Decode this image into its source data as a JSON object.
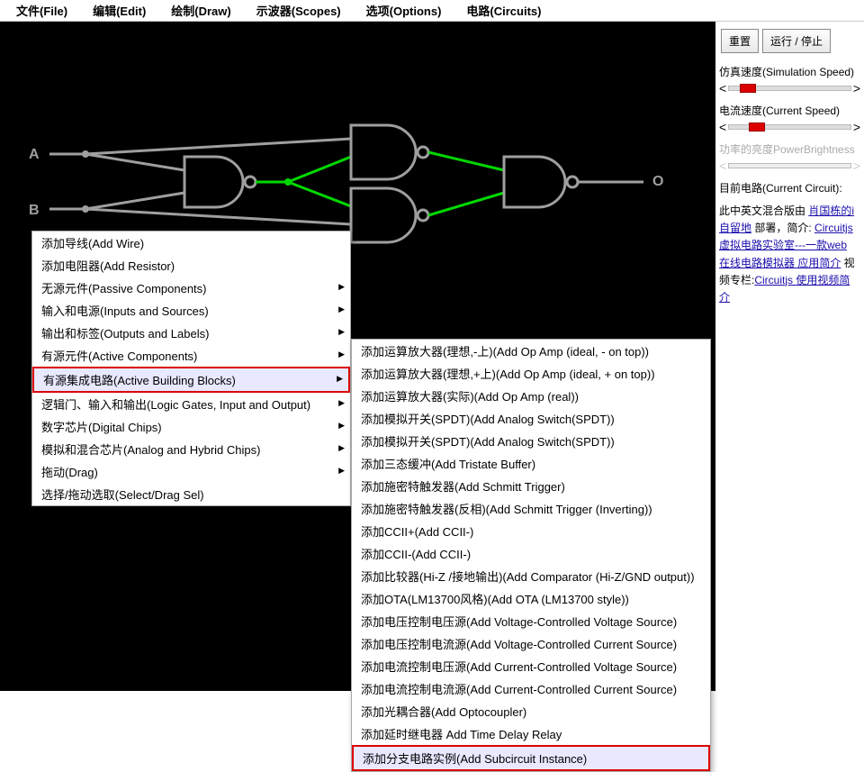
{
  "menubar": {
    "items": [
      {
        "label": "文件(File)"
      },
      {
        "label": "编辑(Edit)"
      },
      {
        "label": "绘制(Draw)"
      },
      {
        "label": "示波器(Scopes)"
      },
      {
        "label": "选项(Options)"
      },
      {
        "label": "电路(Circuits)"
      }
    ]
  },
  "buttons": {
    "reset": "重置",
    "run_stop": "运行 / 停止"
  },
  "sliders": {
    "sim_speed": "仿真速度(Simulation Speed)",
    "current_speed": "电流速度(Current Speed)",
    "power_brightness": "功率的亮度PowerBrightness"
  },
  "labels": {
    "current_circuit": "目前电路(Current Circuit):",
    "input_a": "A",
    "input_b": "B",
    "output_o": "O"
  },
  "info": {
    "t1": "此中英文混合版由 ",
    "link1": "肖国栋的i自留地",
    "t2": " 部署，简介: ",
    "link2": "Circuitjs 虚拟电路实验室---一款web 在线电路模拟器 应用简介",
    "t3": " 视频专栏:",
    "link3": "Circuitjs 使用视频简介"
  },
  "context_menu_1": {
    "items": [
      {
        "label": "添加导线(Add Wire)"
      },
      {
        "label": "添加电阻器(Add Resistor)"
      },
      {
        "label": "无源元件(Passive Components)",
        "sub": true
      },
      {
        "label": "输入和电源(Inputs and Sources)",
        "sub": true
      },
      {
        "label": "输出和标签(Outputs and Labels)",
        "sub": true
      },
      {
        "label": "有源元件(Active Components)",
        "sub": true
      },
      {
        "label": "有源集成电路(Active Building Blocks)",
        "sub": true,
        "highlighted": true,
        "redbox": true
      },
      {
        "label": "逻辑门、输入和输出(Logic Gates, Input and Output)",
        "sub": true
      },
      {
        "label": "数字芯片(Digital Chips)",
        "sub": true
      },
      {
        "label": "模拟和混合芯片(Analog and Hybrid Chips)",
        "sub": true
      },
      {
        "label": "拖动(Drag)",
        "sub": true
      },
      {
        "label": "选择/拖动选取(Select/Drag Sel)"
      }
    ]
  },
  "context_menu_2": {
    "items": [
      {
        "label": "添加运算放大器(理想,-上)(Add Op Amp (ideal, - on top))"
      },
      {
        "label": "添加运算放大器(理想,+上)(Add Op Amp (ideal, + on top))"
      },
      {
        "label": "添加运算放大器(实际)(Add Op Amp (real))"
      },
      {
        "label": "添加模拟开关(SPDT)(Add Analog Switch(SPDT))"
      },
      {
        "label": "添加模拟开关(SPDT)(Add Analog Switch(SPDT))"
      },
      {
        "label": "添加三态缓冲(Add Tristate Buffer)"
      },
      {
        "label": "添加施密特触发器(Add Schmitt Trigger)"
      },
      {
        "label": "添加施密特触发器(反相)(Add Schmitt Trigger (Inverting))"
      },
      {
        "label": "添加CCII+(Add CCII-)"
      },
      {
        "label": "添加CCII-(Add CCII-)"
      },
      {
        "label": "添加比较器(Hi-Z /接地输出)(Add Comparator (Hi-Z/GND output))"
      },
      {
        "label": "添加OTA(LM13700风格)(Add OTA (LM13700 style))"
      },
      {
        "label": "添加电压控制电压源(Add Voltage-Controlled Voltage Source)"
      },
      {
        "label": "添加电压控制电流源(Add Voltage-Controlled Current Source)"
      },
      {
        "label": "添加电流控制电压源(Add Current-Controlled Voltage Source)"
      },
      {
        "label": "添加电流控制电流源(Add Current-Controlled Current Source)"
      },
      {
        "label": "添加光耦合器(Add Optocoupler)"
      },
      {
        "label": "添加延时继电器 Add Time Delay Relay"
      },
      {
        "label": "添加分支电路实例(Add Subcircuit Instance)",
        "highlighted": true,
        "redbox": true
      }
    ]
  }
}
